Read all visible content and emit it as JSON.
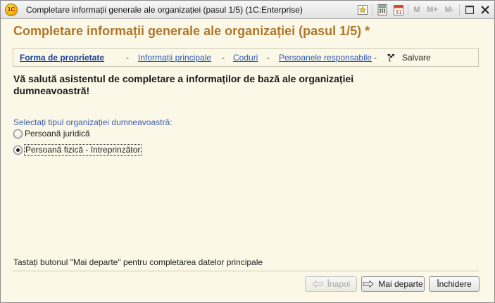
{
  "window": {
    "title": "Completare informații generale ale organizației (pasul 1/5)  (1C:Enterprise)",
    "logo_text": "1C",
    "toolbar": {
      "mem_m": "M",
      "mem_mplus": "M+",
      "mem_mminus": "M-"
    }
  },
  "header": {
    "title": "Completare informații generale ale organizației (pasul 1/5) *"
  },
  "steps": [
    {
      "label": "Forma de proprietate"
    },
    {
      "label": "Informații principale"
    },
    {
      "label": "Coduri"
    },
    {
      "label": "Persoanele responsabile"
    },
    {
      "label": "Salvare"
    }
  ],
  "step_separator": "-",
  "greeting": "Vă salută asistentul de completare a informaților de bază ale organizației dumneavoastră!",
  "organization_type": {
    "label": "Selectați tipul organizației dumneavoastră:",
    "options": [
      {
        "label": "Persoană juridică",
        "selected": false
      },
      {
        "label": "Persoană fizică - întreprinzător",
        "selected": true
      }
    ]
  },
  "hint": "Tastați butonul \"Mai departe\" pentru completarea datelor principale",
  "buttons": {
    "back": "Înapoi",
    "next": "Mai departe",
    "close": "Închidere"
  },
  "colors": {
    "header_title": "#b0762a",
    "link": "#2b58b4",
    "background": "#fbf8e8"
  }
}
